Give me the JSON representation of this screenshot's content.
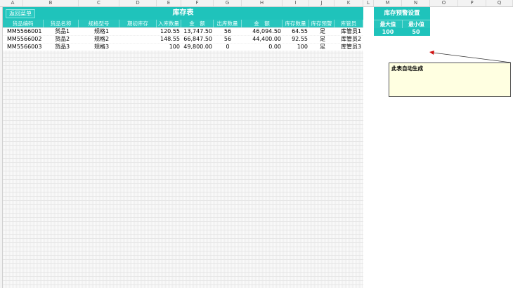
{
  "columns": [
    "A",
    "B",
    "C",
    "D",
    "E",
    "F",
    "G",
    "H",
    "I",
    "J",
    "K",
    "L",
    "M",
    "N",
    "O",
    "P",
    "Q"
  ],
  "table": {
    "title": "库存表",
    "back_button": "返回菜单",
    "headers": [
      "货品编码",
      "货品名称",
      "规格型号",
      "期初库存",
      "入库数量",
      "金　额",
      "出库数量",
      "金　额",
      "库存数量",
      "库存预警",
      "库管员"
    ],
    "rows": [
      [
        "MM5566001",
        "货品1",
        "规格1",
        "",
        "120.55",
        "13,747.50",
        "56",
        "46,094.50",
        "64.55",
        "足",
        "库管员1"
      ],
      [
        "MM5566002",
        "货品2",
        "规格2",
        "",
        "148.55",
        "66,847.50",
        "56",
        "44,400.00",
        "92.55",
        "足",
        "库管员2"
      ],
      [
        "MM5566003",
        "货品3",
        "规格3",
        "",
        "100",
        "49,800.00",
        "0",
        "0.00",
        "100",
        "足",
        "库管员3"
      ]
    ]
  },
  "warning": {
    "title": "库存预警设置",
    "max_label": "最大值",
    "min_label": "最小值",
    "max_value": "100",
    "min_value": "50"
  },
  "comment": {
    "text": "此表自动生成"
  },
  "colors": {
    "accent": "#1fc3bb",
    "comment_bg": "#ffffe1"
  }
}
